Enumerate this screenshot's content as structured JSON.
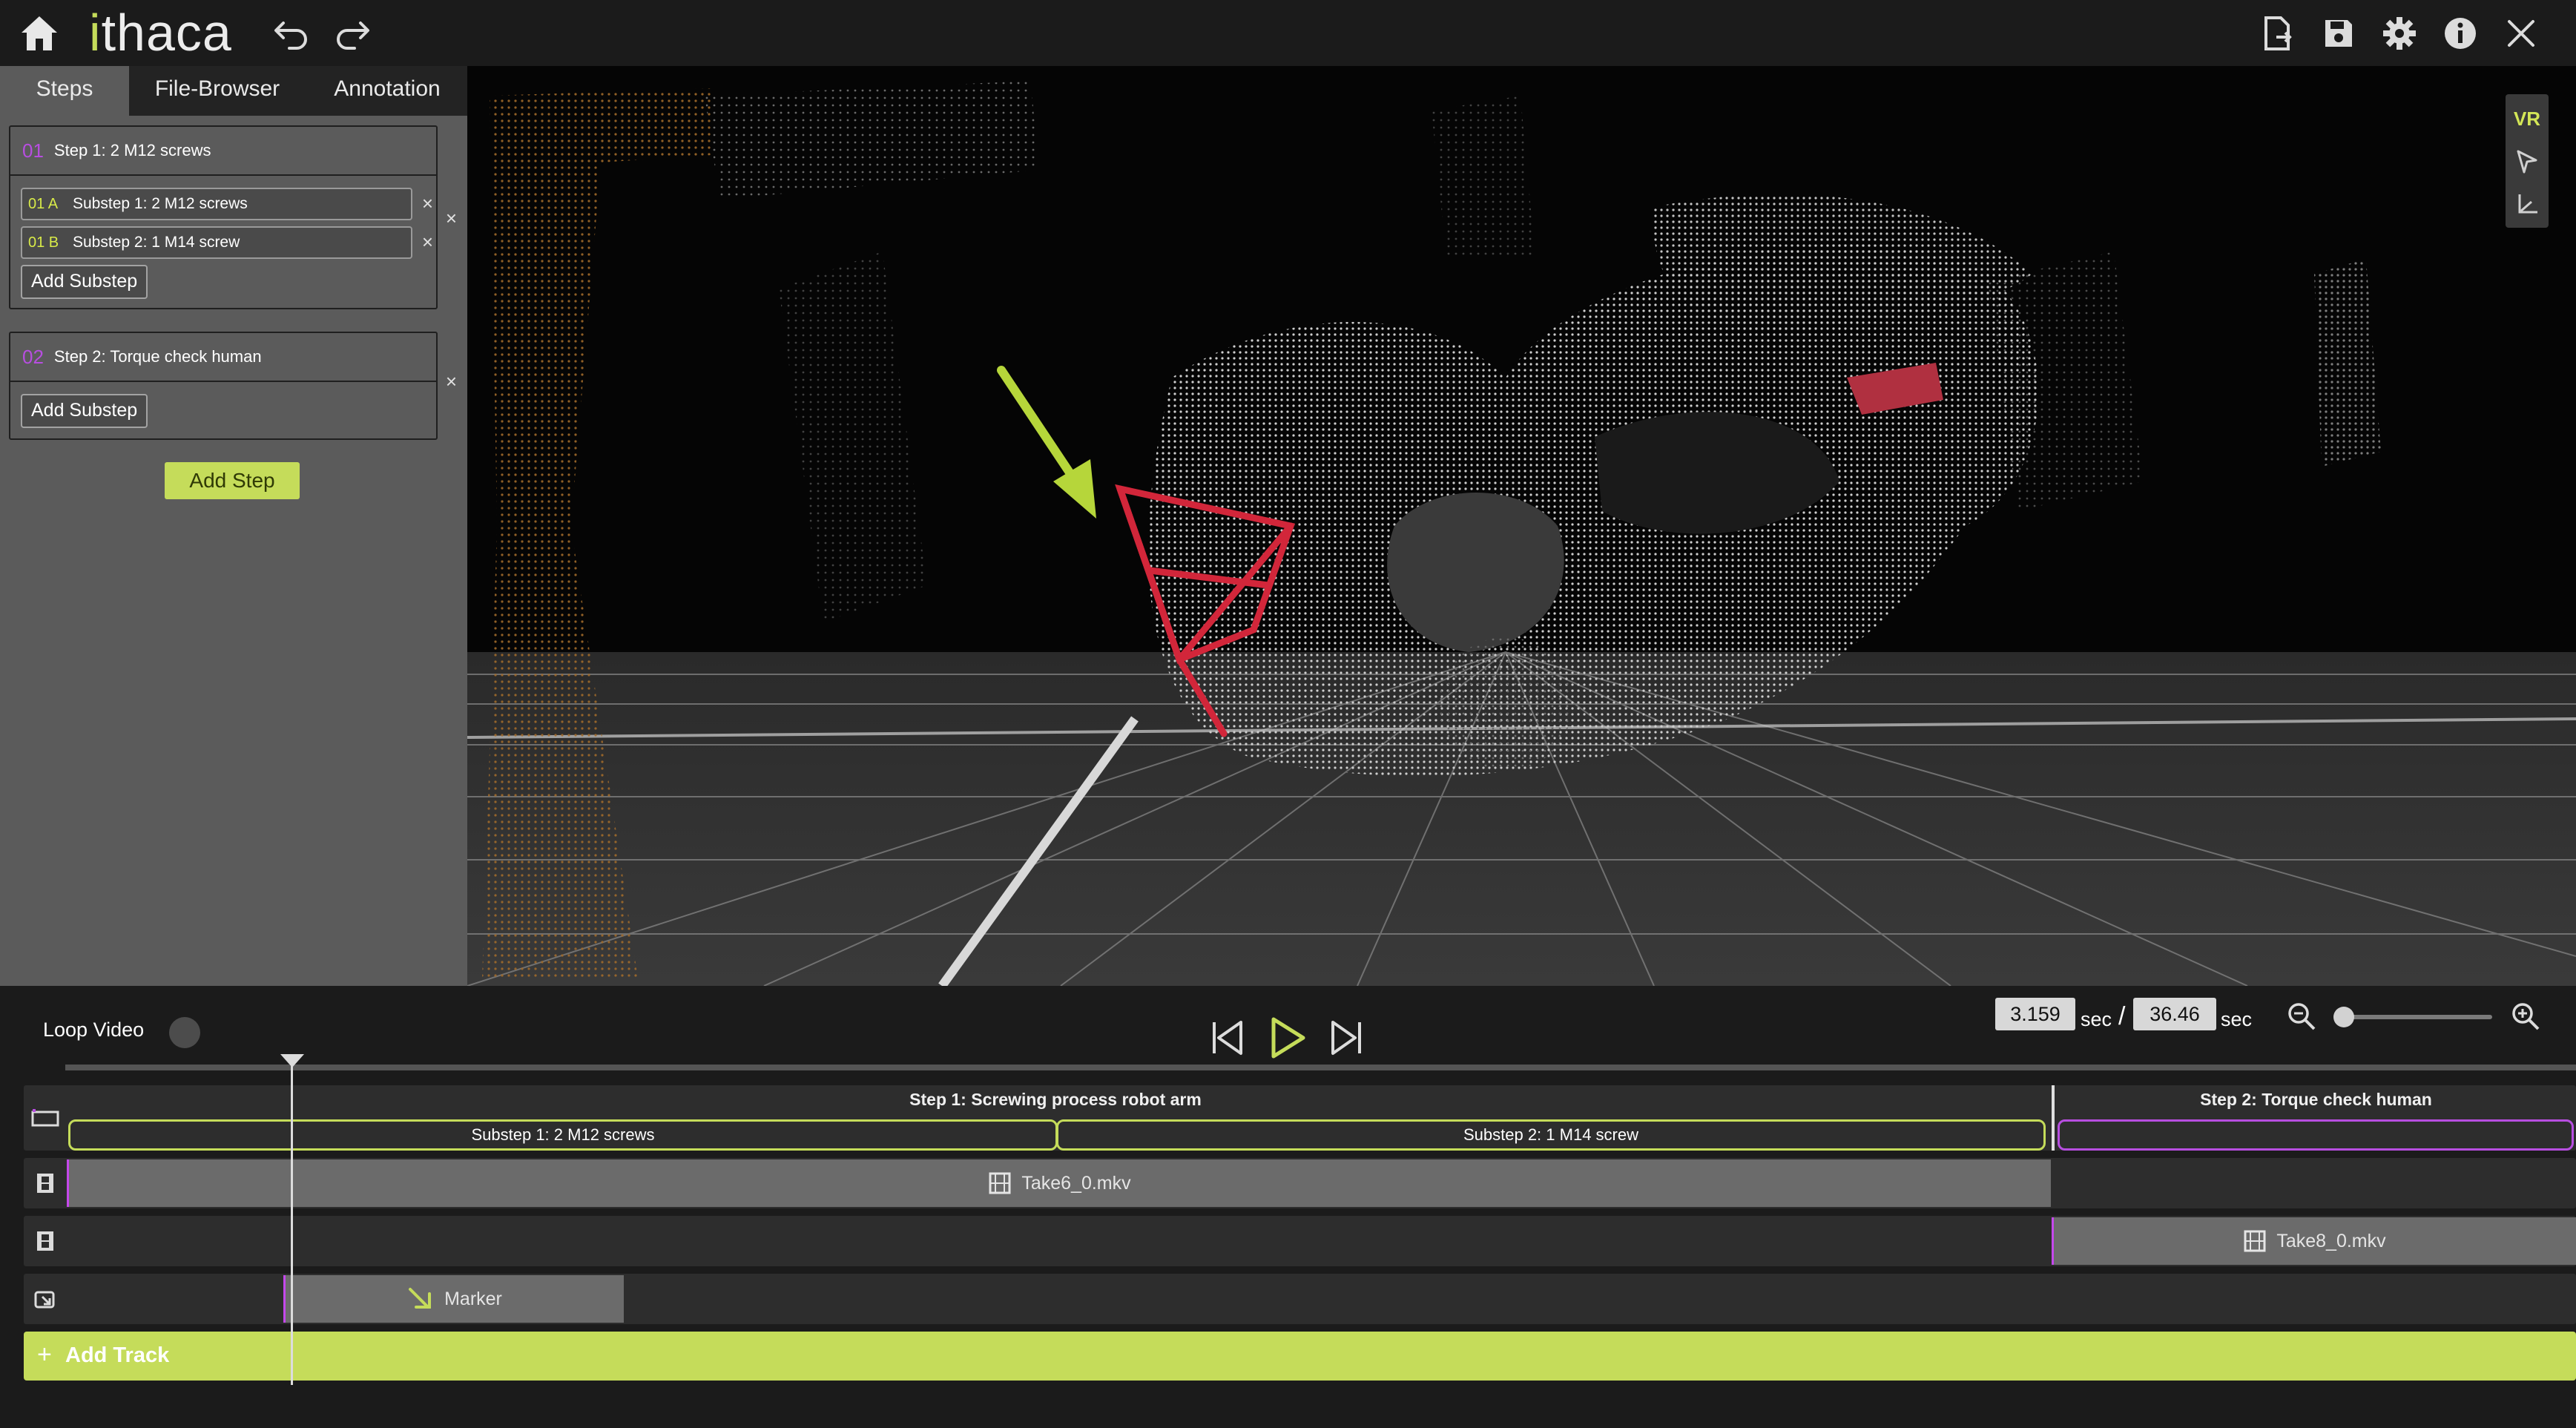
{
  "app": {
    "logo": "ithaca",
    "toolbar_icons": [
      "home-icon",
      "undo-icon",
      "redo-icon",
      "export-icon",
      "save-icon",
      "settings-icon",
      "info-icon",
      "close-icon"
    ]
  },
  "tabs": [
    {
      "label": "Steps",
      "active": true
    },
    {
      "label": "File-Browser",
      "active": false
    },
    {
      "label": "Annotation",
      "active": false
    }
  ],
  "steps": [
    {
      "number": "01",
      "title": "Step 1: 2 M12 screws",
      "substeps": [
        {
          "number": "01 A",
          "label": "Substep 1: 2 M12 screws"
        },
        {
          "number": "01 B",
          "label": "Substep 2: 1 M14 screw"
        }
      ],
      "add_substep_label": "Add Substep"
    },
    {
      "number": "02",
      "title": "Step 2: Torque check human",
      "substeps": [],
      "add_substep_label": "Add Substep"
    }
  ],
  "add_step_label": "Add Step",
  "viewport": {
    "vr_label": "VR",
    "tools": [
      "vr-button",
      "select-arrow-icon",
      "axes-icon"
    ]
  },
  "playback": {
    "loop_label": "Loop Video",
    "loop_enabled": false,
    "current_time": "3.159",
    "total_time": "36.46",
    "unit": "sec",
    "separator": "/"
  },
  "timeline": {
    "steps": [
      {
        "label": "Step 1: Screwing process robot arm"
      },
      {
        "label": "Step 2: Torque check human"
      }
    ],
    "substeps": [
      {
        "label": "Substep 1: 2 M12 screws"
      },
      {
        "label": "Substep 2: 1 M14 screw"
      }
    ],
    "video_clips": [
      {
        "label": "Take6_0.mkv"
      },
      {
        "label": "Take8_0.mkv"
      }
    ],
    "marker_label": "Marker",
    "add_track_label": "Add Track"
  },
  "colors": {
    "accent": "#c5dc5a",
    "purple": "#b74ee0",
    "panel": "#5b5b5b",
    "background": "#1b1b1b"
  }
}
